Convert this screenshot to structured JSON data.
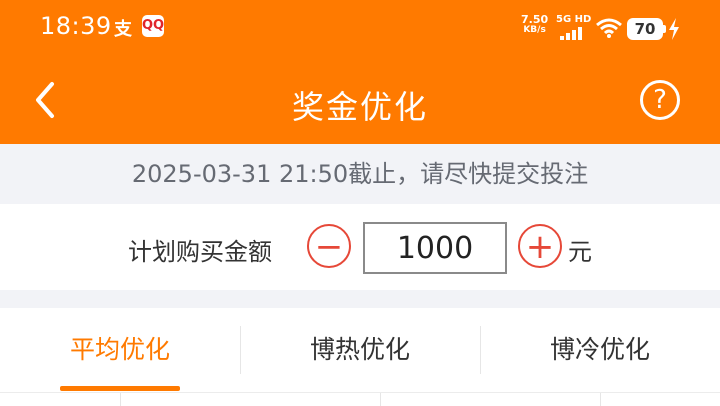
{
  "status_bar": {
    "time": "18:39",
    "app_icon_1": "支",
    "app_icon_2": "QQ",
    "net_speed_value": "7.50",
    "net_speed_unit": "KB/s",
    "signal_label": "5G HD",
    "battery": "70",
    "icons": [
      "alipay-icon",
      "app-icon",
      "signal-icon",
      "wifi-icon",
      "battery-icon",
      "charging-icon"
    ]
  },
  "header": {
    "title": "奖金优化",
    "back_icon": "chevron-left-icon",
    "help_symbol": "?",
    "background": "#ff7a00"
  },
  "deadline": {
    "text": "2025-03-31 21:50截止，请尽快提交投注"
  },
  "amount": {
    "label": "计划购买金额",
    "minus_symbol": "−",
    "value": "1000",
    "plus_symbol": "+",
    "unit": "元"
  },
  "tabs": [
    {
      "label": "平均优化",
      "active": true
    },
    {
      "label": "博热优化",
      "active": false
    },
    {
      "label": "博冷优化",
      "active": false
    }
  ],
  "colors": {
    "accent": "#ff7a00",
    "stepper": "#e64838"
  }
}
